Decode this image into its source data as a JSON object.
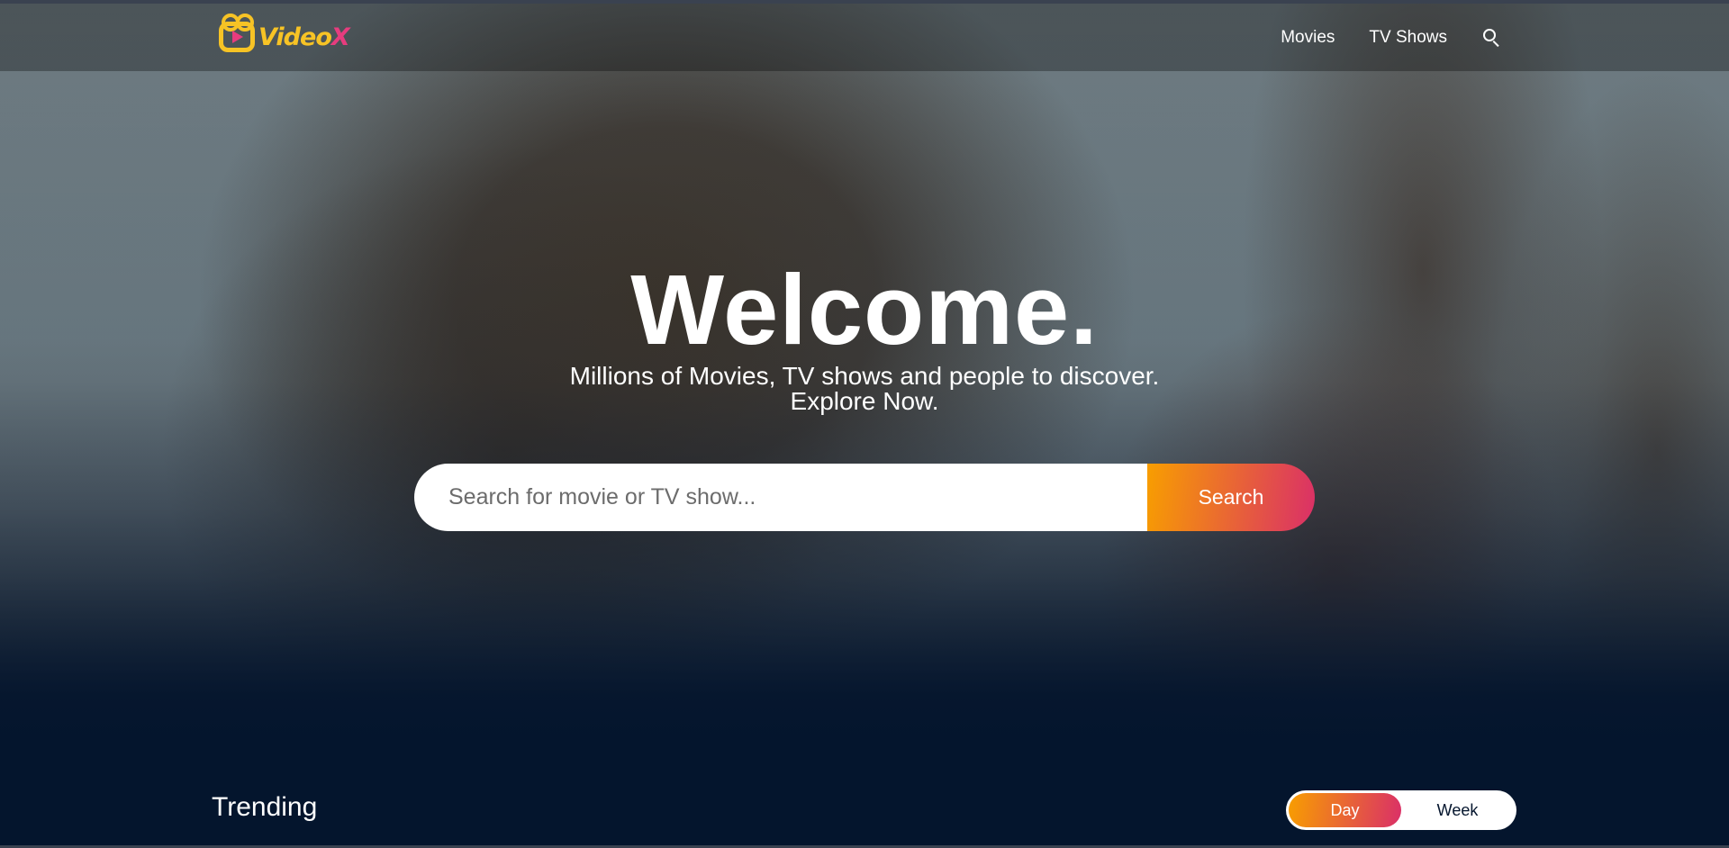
{
  "header": {
    "logo_text_main": "Video",
    "logo_text_x": "X",
    "logo_tagline": "",
    "nav": [
      {
        "label": "Movies"
      },
      {
        "label": "TV Shows"
      }
    ],
    "search_icon": "search-icon"
  },
  "hero": {
    "title": "Welcome.",
    "subtitle_line1": "Millions of Movies, TV shows and people to discover.",
    "subtitle_line2": "Explore Now.",
    "search": {
      "placeholder": "Search for movie or TV show...",
      "value": "",
      "button_label": "Search"
    }
  },
  "trending": {
    "title": "Trending",
    "tabs": [
      {
        "label": "Day",
        "active": true
      },
      {
        "label": "Week",
        "active": false
      }
    ]
  },
  "colors": {
    "accent_start": "#f89e00",
    "accent_end": "#da2f68",
    "logo_yellow": "#f7c325",
    "logo_pink": "#e73c7e",
    "page_bg": "#04152d"
  }
}
